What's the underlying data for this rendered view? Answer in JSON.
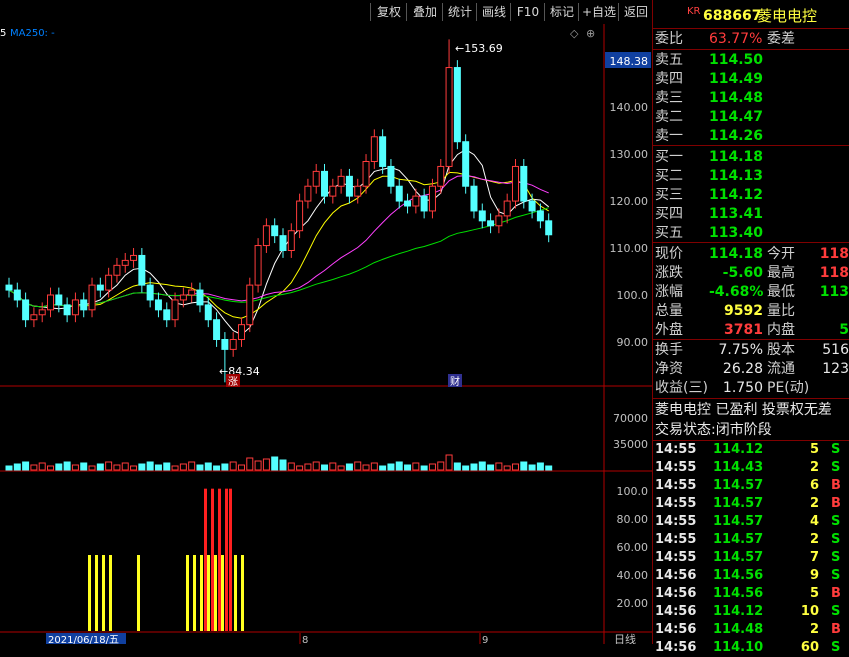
{
  "toolbar": {
    "buttons": [
      "复权",
      "叠加",
      "统计",
      "画线",
      "F10",
      "标记",
      "+自选",
      "返回"
    ]
  },
  "chart": {
    "ma_label": "MA250: -",
    "ma_prefix": "5",
    "price_box": "148.38",
    "price_axis": [
      "140.00",
      "130.00",
      "120.00",
      "110.00",
      "100.0",
      "90.00"
    ],
    "high_label": "153.69",
    "low_label": "84.34",
    "marker_zhang": "涨",
    "marker_cai": "财",
    "vol_axis": [
      "70000",
      "35000"
    ],
    "ind_axis": [
      "100.0",
      "80.00",
      "60.00",
      "40.00",
      "20.00"
    ],
    "date_label": "2021/06/18/五",
    "month_8": "8",
    "month_9": "9",
    "rixian": "日线",
    "colors": {
      "up": "#ff3c3c",
      "down": "#54ffff",
      "ma5": "#ffffff",
      "ma10": "#ffff00",
      "ma20": "#ff40ff",
      "ma60": "#00e000",
      "frame": "#b00000"
    }
  },
  "chart_data": {
    "type": "candlestick",
    "ylim": [
      84,
      156
    ],
    "high": 153.69,
    "low": 84.34,
    "closes": [
      103,
      101,
      97,
      98,
      99,
      102,
      100,
      98,
      101,
      99,
      104,
      103,
      106,
      108,
      109,
      110,
      104,
      101,
      99,
      97,
      101,
      102,
      103,
      100,
      97,
      93,
      91,
      93,
      96,
      104,
      112,
      116,
      114,
      111,
      115,
      121,
      124,
      127,
      122,
      124,
      126,
      122,
      124,
      129,
      134,
      128,
      124,
      121,
      120,
      122,
      119,
      124,
      128,
      148,
      133,
      124,
      119,
      117,
      116,
      118,
      121,
      128,
      121,
      119,
      117,
      114.18
    ],
    "volume_axis": [
      "70000",
      "35000"
    ],
    "indicator_bars": [
      {
        "x": 88,
        "v": 55,
        "c": "yellow"
      },
      {
        "x": 95,
        "v": 55,
        "c": "yellow"
      },
      {
        "x": 102,
        "v": 55,
        "c": "yellow"
      },
      {
        "x": 109,
        "v": 55,
        "c": "yellow"
      },
      {
        "x": 137,
        "v": 55,
        "c": "yellow"
      },
      {
        "x": 186,
        "v": 55,
        "c": "yellow"
      },
      {
        "x": 193,
        "v": 55,
        "c": "yellow"
      },
      {
        "x": 200,
        "v": 55,
        "c": "yellow"
      },
      {
        "x": 204,
        "v": 103,
        "c": "red"
      },
      {
        "x": 211,
        "v": 103,
        "c": "red"
      },
      {
        "x": 218,
        "v": 103,
        "c": "red"
      },
      {
        "x": 225,
        "v": 103,
        "c": "red"
      },
      {
        "x": 229,
        "v": 103,
        "c": "red"
      },
      {
        "x": 207,
        "v": 55,
        "c": "yellow"
      },
      {
        "x": 214,
        "v": 55,
        "c": "yellow"
      },
      {
        "x": 221,
        "v": 55,
        "c": "yellow"
      },
      {
        "x": 234,
        "v": 55,
        "c": "yellow"
      },
      {
        "x": 241,
        "v": 55,
        "c": "yellow"
      }
    ]
  },
  "panel": {
    "kr": "KR",
    "code": "688667",
    "name": "菱电电控",
    "weibi_label": "委比",
    "weibi_value": "63.77%",
    "weicha_label": "委差",
    "asks": [
      {
        "label": "卖五",
        "price": "114.50"
      },
      {
        "label": "卖四",
        "price": "114.49"
      },
      {
        "label": "卖三",
        "price": "114.48"
      },
      {
        "label": "卖二",
        "price": "114.47"
      },
      {
        "label": "卖一",
        "price": "114.26"
      }
    ],
    "bids": [
      {
        "label": "买一",
        "price": "114.18"
      },
      {
        "label": "买二",
        "price": "114.13"
      },
      {
        "label": "买三",
        "price": "114.12"
      },
      {
        "label": "买四",
        "price": "113.41"
      },
      {
        "label": "买五",
        "price": "113.40"
      }
    ],
    "quote": [
      {
        "l1": "现价",
        "v1": "114.18",
        "c1": "green",
        "l2": "今开",
        "v2": "118",
        "c2": "red"
      },
      {
        "l1": "涨跌",
        "v1": "-5.60",
        "c1": "green",
        "l2": "最高",
        "v2": "118",
        "c2": "red"
      },
      {
        "l1": "涨幅",
        "v1": "-4.68%",
        "c1": "green",
        "l2": "最低",
        "v2": "113",
        "c2": "green"
      },
      {
        "l1": "总量",
        "v1": "9592",
        "c1": "yellow",
        "l2": "量比",
        "v2": "",
        "c2": "white"
      },
      {
        "l1": "外盘",
        "v1": "3781",
        "c1": "red",
        "l2": "内盘",
        "v2": "5",
        "c2": "green"
      }
    ],
    "stats": [
      {
        "l1": "换手",
        "v1": "7.75%",
        "l2": "股本",
        "v2": "516"
      },
      {
        "l1": "净资",
        "v1": "26.28",
        "l2": "流通",
        "v2": "123"
      },
      {
        "l1": "收益(三)",
        "v1": "1.750",
        "l2": "PE(动)",
        "v2": ""
      }
    ],
    "info1": "菱电电控 已盈利 投票权无差",
    "info2": "交易状态:闭市阶段",
    "ticks": [
      {
        "t": "14:55",
        "p": "114.12",
        "v": "5",
        "d": "S"
      },
      {
        "t": "14:55",
        "p": "114.43",
        "v": "2",
        "d": "S"
      },
      {
        "t": "14:55",
        "p": "114.57",
        "v": "6",
        "d": "B"
      },
      {
        "t": "14:55",
        "p": "114.57",
        "v": "2",
        "d": "B"
      },
      {
        "t": "14:55",
        "p": "114.57",
        "v": "4",
        "d": "S"
      },
      {
        "t": "14:55",
        "p": "114.57",
        "v": "2",
        "d": "S"
      },
      {
        "t": "14:55",
        "p": "114.57",
        "v": "7",
        "d": "S"
      },
      {
        "t": "14:56",
        "p": "114.56",
        "v": "9",
        "d": "S"
      },
      {
        "t": "14:56",
        "p": "114.56",
        "v": "5",
        "d": "B"
      },
      {
        "t": "14:56",
        "p": "114.12",
        "v": "10",
        "d": "S"
      },
      {
        "t": "14:56",
        "p": "114.48",
        "v": "2",
        "d": "B"
      },
      {
        "t": "14:56",
        "p": "114.10",
        "v": "60",
        "d": "S"
      }
    ]
  }
}
